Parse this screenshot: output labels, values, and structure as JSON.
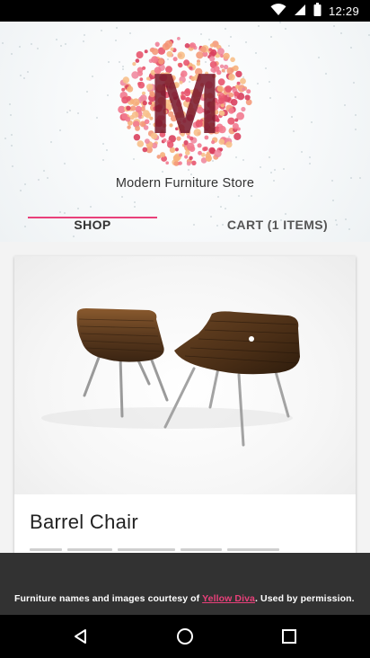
{
  "status_bar": {
    "time": "12:29",
    "icons": [
      "wifi-icon",
      "signal-icon",
      "battery-icon"
    ]
  },
  "header": {
    "logo_letter": "M",
    "store_name": "Modern Furniture Store",
    "tabs": [
      {
        "label": "SHOP",
        "active": true
      },
      {
        "label": "CART (1 ITEMS)",
        "active": false
      }
    ]
  },
  "products": [
    {
      "title": "Barrel Chair"
    }
  ],
  "snackbar": {
    "prefix": "Furniture names and images courtesy of ",
    "link": "Yellow Diva",
    "suffix": ". Used by permission."
  },
  "nav_bar": {
    "buttons": [
      "back-icon",
      "home-icon",
      "recents-icon"
    ]
  },
  "colors": {
    "accent": "#e9407a",
    "snackbar_bg": "#323232"
  }
}
